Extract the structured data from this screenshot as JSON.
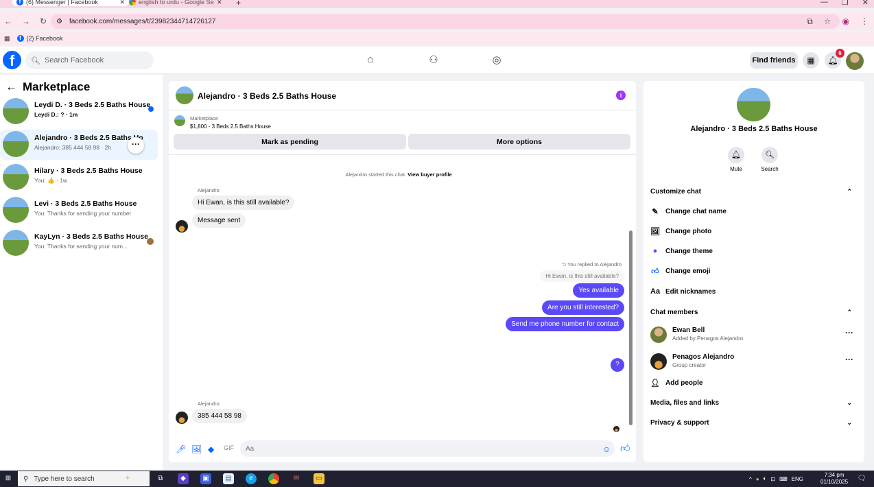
{
  "browser": {
    "tabs": [
      {
        "label": "(6) Messenger | Facebook"
      },
      {
        "label": "english to urdu - Google Search"
      }
    ],
    "url": "facebook.com/messages/t/23982344714726127",
    "bookmark": "(2) Facebook"
  },
  "fb": {
    "search_placeholder": "Search Facebook",
    "find_friends": "Find friends",
    "notif_count": "6"
  },
  "left": {
    "title": "Marketplace",
    "conversations": [
      {
        "name": "Leydi D. · 3 Beds 2.5 Baths House",
        "preview": "Leydi D.: ? · 1m"
      },
      {
        "name": "Alejandro · 3 Beds 2.5 Baths Ho",
        "preview": "Alejandro: 385 444 58 98 · 2h"
      },
      {
        "name": "Hilary · 3 Beds 2.5 Baths House",
        "preview": "You: 👍 · 1w"
      },
      {
        "name": "Levi · 3 Beds 2.5 Baths House",
        "preview": "You: Thanks for sending your number"
      },
      {
        "name": "KayLyn · 3 Beds 2.5 Baths House",
        "preview": "You: Thanks for sending your num..."
      }
    ]
  },
  "chat": {
    "title": "Alejandro · 3 Beds 2.5 Baths House",
    "listing_source": "Marketplace",
    "listing_title": "$1,800 - 3 Beds 2.5 Baths House",
    "mark_pending": "Mark as pending",
    "more_options": "More options",
    "system_text": "Alejandro started this chat.",
    "system_link": "View buyer profile",
    "sender_name": "Alejandro",
    "msg_in_1": "Hi Ewan, is this still available?",
    "msg_in_2": "Message sent",
    "reply_note": "You replied to Alejandro",
    "quoted": "Hi Ewan, is this still available?",
    "msg_out_1": "Yes available",
    "msg_out_2": "Are you still interested?",
    "msg_out_3": "Send me phone number for contact",
    "msg_out_4": "?",
    "sender_name_2": "Alejandro",
    "msg_in_3": "385 444 58 98",
    "input_placeholder": "Aa"
  },
  "right": {
    "title": "Alejandro · 3 Beds 2.5 Baths House",
    "mute": "Mute",
    "search": "Search",
    "customize": "Customize chat",
    "change_name": "Change chat name",
    "change_photo": "Change photo",
    "change_theme": "Change theme",
    "change_emoji": "Change emoji",
    "edit_nicknames": "Edit nicknames",
    "members_header": "Chat members",
    "members": [
      {
        "name": "Ewan Bell",
        "sub": "Added by Penagos Alejandro"
      },
      {
        "name": "Penagos Alejandro",
        "sub": "Group creator"
      }
    ],
    "add_people": "Add people",
    "media": "Media, files and links",
    "privacy": "Privacy & support"
  },
  "taskbar": {
    "search_placeholder": "Type here to search",
    "lang": "ENG",
    "time": "7:34 pm",
    "date": "01/10/2025",
    "notif": "2"
  },
  "colors": {
    "fb_blue": "#0866ff",
    "bubble_out": "#5b49f7",
    "badge_red": "#e41e3f"
  }
}
